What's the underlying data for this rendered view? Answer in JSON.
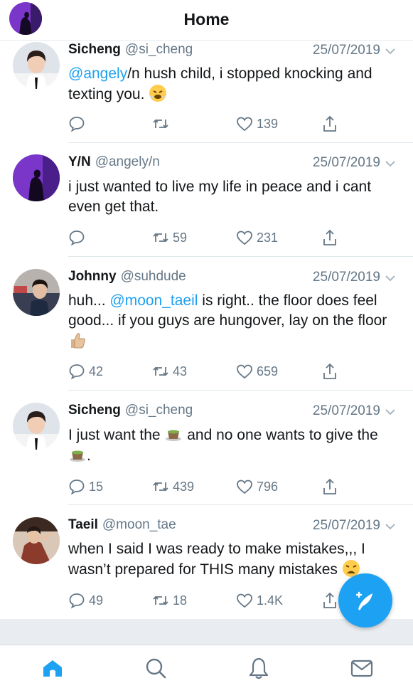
{
  "header": {
    "title": "Home",
    "avatar_icon": "profile-avatar"
  },
  "tweets": [
    {
      "name": "Sicheng",
      "handle": "@si_cheng",
      "date": "25/07/2019",
      "mention": "@angely",
      "text": "/n hush child, i stopped knocking and texting you.",
      "emoji": "steam-face-emoji",
      "replies": "",
      "retweets": "",
      "likes": "139",
      "avatar_color": "#d9dde4"
    },
    {
      "name": "Y/N",
      "handle": "@angely/n",
      "date": "25/07/2019",
      "text": "i just wanted to live my life in peace and i cant even get that.",
      "replies": "",
      "retweets": "59",
      "likes": "231",
      "avatar_color": "#6a2bb8"
    },
    {
      "name": "Johnny",
      "handle": "@suhdude",
      "date": "25/07/2019",
      "text_before": "huh... ",
      "mention": "@moon_taeil",
      "text_after": " is right.. the floor does feel good... if you guys are hungover, lay on the floor",
      "emoji": "thumbs-up-emoji",
      "replies": "42",
      "retweets": "43",
      "likes": "659",
      "avatar_color": "#8a6a5a"
    },
    {
      "name": "Sicheng",
      "handle": "@si_cheng",
      "date": "25/07/2019",
      "text_before": "I just want the ",
      "text_after": " and no one wants to give the ",
      "text_end": ".",
      "emoji": "tea-cup-emoji",
      "replies": "15",
      "retweets": "439",
      "likes": "796",
      "avatar_color": "#d9dde4"
    },
    {
      "name": "Taeil",
      "handle": "@moon_tae",
      "date": "25/07/2019",
      "text": "when I said I was ready to make mistakes,,, I wasn’t prepared for THIS many mistakes",
      "emoji": "weary-face-emoji",
      "replies": "49",
      "retweets": "18",
      "likes": "1.4K",
      "avatar_color": "#7a3a2a"
    }
  ],
  "tabbar": {
    "items": [
      "home-icon",
      "search-icon",
      "notifications-icon",
      "messages-icon"
    ]
  },
  "colors": {
    "accent": "#1da1f2",
    "secondary_text": "#657786"
  }
}
